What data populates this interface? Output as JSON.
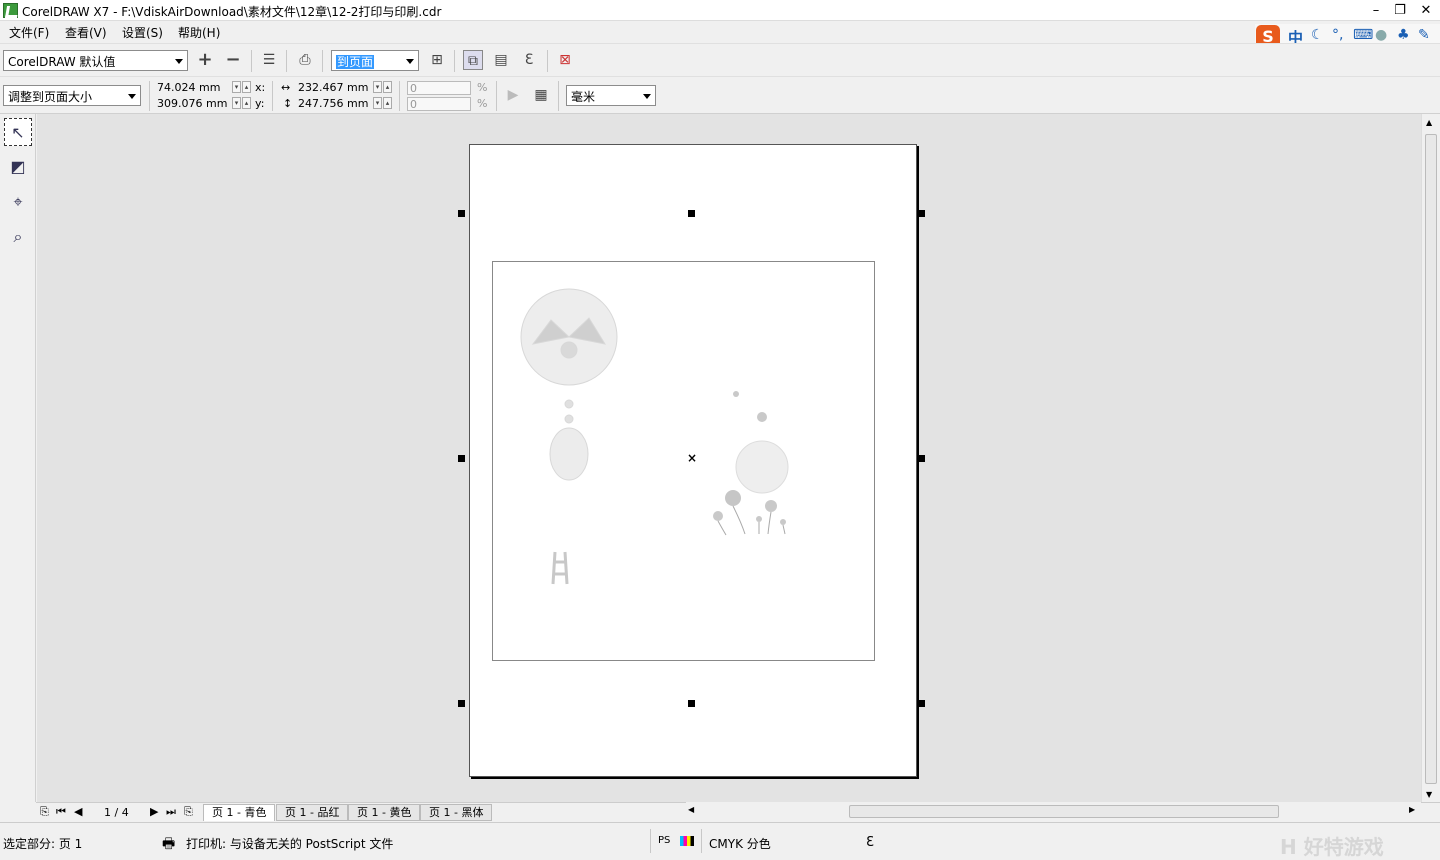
{
  "window": {
    "title": "CorelDRAW X7 - F:\\VdiskAirDownload\\素材文件\\12章\\12-2打印与印刷.cdr",
    "minimize": "–",
    "restore": "❐",
    "close": "✕"
  },
  "menu": [
    "文件(F)",
    "查看(V)",
    "设置(S)",
    "帮助(H)"
  ],
  "toolbar": {
    "preset": "CorelDRAW 默认值",
    "add": "+",
    "remove": "−",
    "fit_option": "到页面"
  },
  "property_bar": {
    "size_mode": "调整到页面大小",
    "x": "74.024 mm",
    "y": "309.076 mm",
    "x_label": "x:",
    "y_label": "y:",
    "width": "232.467 mm",
    "height": "247.756 mm",
    "scale_x": "0",
    "scale_y": "0",
    "percent": "%",
    "units": "毫米"
  },
  "page_nav": {
    "counter": "1 / 4",
    "tabs": [
      "页 1 - 青色",
      "页 1 - 品红",
      "页 1 - 黄色",
      "页 1 - 黑体"
    ],
    "active_tab": 0
  },
  "status": {
    "selection": "选定部分: 页 1",
    "printer": "打印机: 与设备无关的 PostScript 文件",
    "separation": "CMYK 分色"
  },
  "ime": {
    "lang": "中",
    "logo": "S"
  },
  "watermark": "H 好特游戏"
}
